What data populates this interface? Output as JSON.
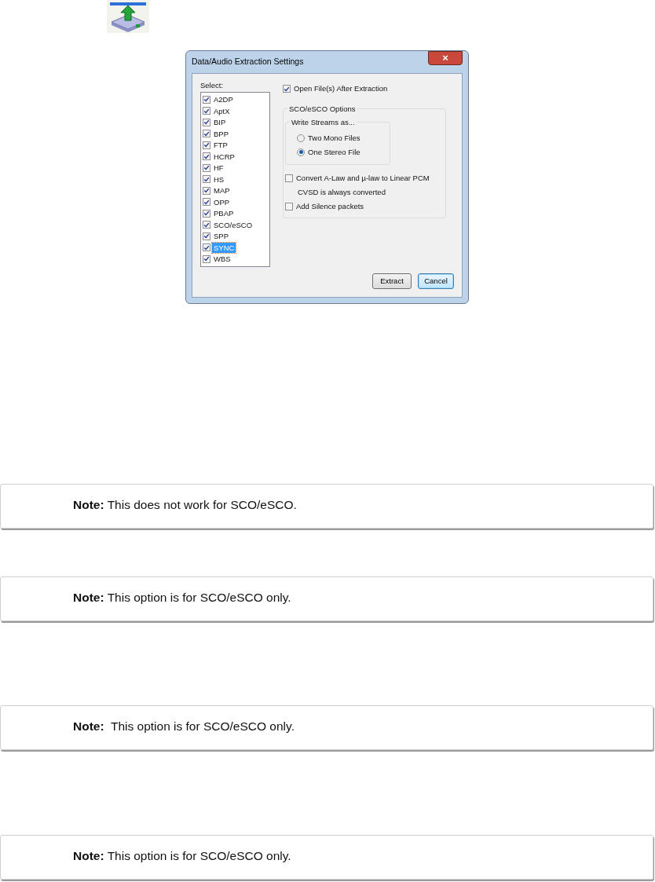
{
  "dialog": {
    "title": "Data/Audio Extraction Settings",
    "close": "×",
    "select_label": "Select:",
    "profiles": [
      {
        "label": "A2DP",
        "checked": true,
        "selected": false
      },
      {
        "label": "AptX",
        "checked": true,
        "selected": false
      },
      {
        "label": "BIP",
        "checked": true,
        "selected": false
      },
      {
        "label": "BPP",
        "checked": true,
        "selected": false
      },
      {
        "label": "FTP",
        "checked": true,
        "selected": false
      },
      {
        "label": "HCRP",
        "checked": true,
        "selected": false
      },
      {
        "label": "HF",
        "checked": true,
        "selected": false
      },
      {
        "label": "HS",
        "checked": true,
        "selected": false
      },
      {
        "label": "MAP",
        "checked": true,
        "selected": false
      },
      {
        "label": "OPP",
        "checked": true,
        "selected": false
      },
      {
        "label": "PBAP",
        "checked": true,
        "selected": false
      },
      {
        "label": "SCO/eSCO",
        "checked": true,
        "selected": false
      },
      {
        "label": "SPP",
        "checked": true,
        "selected": false
      },
      {
        "label": "SYNC",
        "checked": true,
        "selected": true
      },
      {
        "label": "WBS",
        "checked": true,
        "selected": false
      }
    ],
    "open_after": {
      "label": "Open File(s) After Extraction",
      "checked": true
    },
    "sco_group": {
      "title": "SCO/eSCO Options",
      "streams_group": {
        "title": "Write Streams as...",
        "options": [
          {
            "label": "Two Mono Files",
            "selected": false
          },
          {
            "label": "One Stereo File",
            "selected": true
          }
        ]
      },
      "convert": {
        "label": "Convert A-Law and µ-law to Linear PCM",
        "checked": false
      },
      "convert_note": "CVSD is always converted",
      "silence": {
        "label": "Add Silence packets",
        "checked": false
      }
    },
    "buttons": [
      {
        "label": "Extract",
        "default": false
      },
      {
        "label": "Cancel",
        "default": true
      }
    ]
  },
  "notes": [
    "**Note:** This does not work for SCO/eSCO.",
    "**Note:** This option is for SCO/eSCO only.",
    "**Note:**  This option is for SCO/eSCO only.",
    "**Note:** This option is for SCO/eSCO only."
  ]
}
